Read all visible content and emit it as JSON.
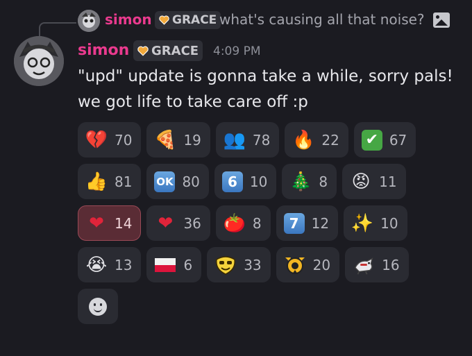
{
  "reply": {
    "author": "simon",
    "tag": "GRACE",
    "text": "what's causing all that noise?"
  },
  "message": {
    "author": "simon",
    "tag": "GRACE",
    "time": "4:09 PM",
    "lines": [
      "\"upd\" update is gonna take a while, sorry pals!",
      "we got life to take care off :p"
    ]
  },
  "reactions": [
    {
      "emoji": "💔",
      "count": "70",
      "me": false
    },
    {
      "emoji": "🍕",
      "count": "19",
      "me": false
    },
    {
      "emoji": "👥",
      "count": "78",
      "me": false
    },
    {
      "emoji": "🔥",
      "count": "22",
      "me": false
    },
    {
      "emoji": "✔",
      "count": "67",
      "me": false
    },
    {
      "emoji": "👍",
      "count": "81",
      "me": false
    },
    {
      "emoji": "OK",
      "count": "80",
      "me": false
    },
    {
      "emoji": "6",
      "count": "10",
      "me": false
    },
    {
      "emoji": "🎄",
      "count": "8",
      "me": false
    },
    {
      "emoji": "😡",
      "count": "11",
      "me": false
    },
    {
      "emoji": "❤",
      "count": "14",
      "me": true
    },
    {
      "emoji": "❤",
      "count": "36",
      "me": false
    },
    {
      "emoji": "🍅",
      "count": "8",
      "me": false
    },
    {
      "emoji": "7",
      "count": "12",
      "me": false
    },
    {
      "emoji": "✨",
      "count": "10",
      "me": false
    },
    {
      "emoji": "😭",
      "count": "13",
      "me": false
    },
    {
      "emoji": "🇵🇱",
      "count": "6",
      "me": false
    },
    {
      "emoji": "😎",
      "count": "33",
      "me": false
    },
    {
      "emoji": "⚙",
      "count": "20",
      "me": false
    },
    {
      "emoji": "🦆",
      "count": "16",
      "me": false
    }
  ],
  "colors": {
    "accent_name": "#ea3a8e",
    "background": "#1b1b21",
    "reaction_bg": "#2a2b32",
    "reaction_active_bg": "#5a2c35"
  }
}
